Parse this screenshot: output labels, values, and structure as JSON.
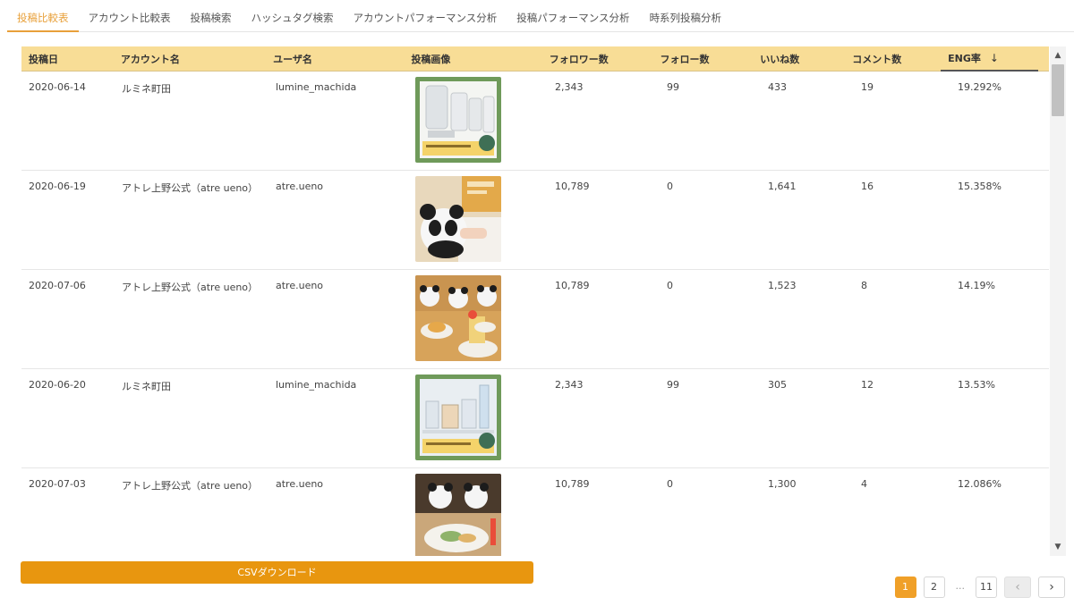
{
  "tabs": [
    {
      "label": "投稿比較表",
      "active": true
    },
    {
      "label": "アカウント比較表"
    },
    {
      "label": "投稿検索"
    },
    {
      "label": "ハッシュタグ検索"
    },
    {
      "label": "アカウントパフォーマンス分析"
    },
    {
      "label": "投稿パフォーマンス分析"
    },
    {
      "label": "時系列投稿分析"
    }
  ],
  "table": {
    "headers": [
      "投稿日",
      "アカウント名",
      "ユーザ名",
      "投稿画像",
      "フォロワー数",
      "フォロー数",
      "いいね数",
      "コメント数",
      "ENG率"
    ],
    "sort_icon": "arrow-down-icon",
    "rows": [
      {
        "date": "2020-06-14",
        "account": "ルミネ町田",
        "user": "lumine_machida",
        "image": "skincare-bottles-photo",
        "followers": "2,343",
        "follows": "99",
        "likes": "433",
        "comments": "19",
        "eng": "19.292%"
      },
      {
        "date": "2020-06-19",
        "account": "アトレ上野公式（atre ueno）",
        "user": "atre.ueno",
        "image": "panda-plush-photo",
        "followers": "10,789",
        "follows": "0",
        "likes": "1,641",
        "comments": "16",
        "eng": "15.358%"
      },
      {
        "date": "2020-07-06",
        "account": "アトレ上野公式（atre ueno）",
        "user": "atre.ueno",
        "image": "panda-desserts-photo",
        "followers": "10,789",
        "follows": "0",
        "likes": "1,523",
        "comments": "8",
        "eng": "14.19%"
      },
      {
        "date": "2020-06-20",
        "account": "ルミネ町田",
        "user": "lumine_machida",
        "image": "cosmetics-photo",
        "followers": "2,343",
        "follows": "99",
        "likes": "305",
        "comments": "12",
        "eng": "13.53%"
      },
      {
        "date": "2020-07-03",
        "account": "アトレ上野公式（atre ueno）",
        "user": "atre.ueno",
        "image": "panda-lunch-photo",
        "followers": "10,789",
        "follows": "0",
        "likes": "1,300",
        "comments": "4",
        "eng": "12.086%"
      }
    ]
  },
  "csv_button": "CSVダウンロード",
  "pagination": {
    "pages": [
      "1",
      "2",
      "...",
      "11"
    ],
    "current": "1",
    "prev_icon": "chevron-left-icon",
    "next_icon": "chevron-right-icon"
  },
  "colors": {
    "accent": "#e8960f",
    "header_bg": "#f8dd96"
  }
}
